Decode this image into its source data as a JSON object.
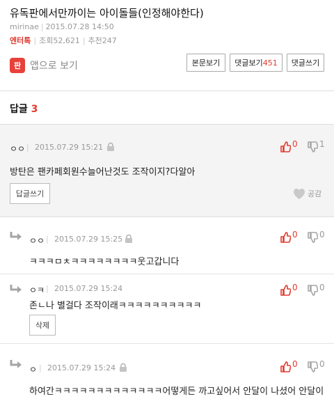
{
  "post": {
    "title": "유독판에서만까이는 아이돌들(인정해야한다)",
    "author": "mirinae",
    "datetime": "2015.07.28 14:50",
    "category": "엔터톡",
    "views_label": "조회52,621",
    "recommend_label": "추천247"
  },
  "app_link": {
    "logo_text": "판",
    "label": "앱으로 보기"
  },
  "toolbar": {
    "view_body": "본문보기",
    "view_comments": "댓글보기",
    "comment_count": "451",
    "write_comment": "댓글쓰기"
  },
  "replies": {
    "heading": "답글",
    "count": "3"
  },
  "main_comment": {
    "author": "ㅇㅇ",
    "datetime": "2015.07.29 15:21",
    "text": "방탄은 팬카페회원수늘어난것도 조작이지?다알아",
    "likes": "0",
    "dislikes": "1",
    "reply_button": "답글쓰기",
    "empathy_label": "공감"
  },
  "reply_comments": [
    {
      "author": "ㅇㅇ",
      "datetime": "2015.07.29 15:25",
      "text": "ㅋㅋㅋㅁㅊㅋㅋㅋㅋㅋㅋㅋㅋ웃고갑니다",
      "likes": "0",
      "dislikes": "0"
    },
    {
      "author": "ㅇㅋ",
      "datetime": "2015.07.29 15:24",
      "text": "존ㄴ나 별걸다 조작이래ㅋㅋㅋㅋㅋㅋㅋㅋㅋㅋ",
      "likes": "0",
      "dislikes": "0",
      "delete_button": "삭제"
    },
    {
      "author": "ㅇ",
      "datetime": "2015.07.29 15:24",
      "text": "하여간ㅋㅋㅋㅋㅋㅋㅋㅋㅋㅋㅋㅋㅋ어떻게든 까고싶어서 안달이 나셨어 안달이",
      "likes": "0",
      "dislikes": "0"
    }
  ],
  "colors": {
    "accent": "#e03a2f",
    "logo": "#e8413a",
    "reply_arrow": "#a5a5a5"
  }
}
